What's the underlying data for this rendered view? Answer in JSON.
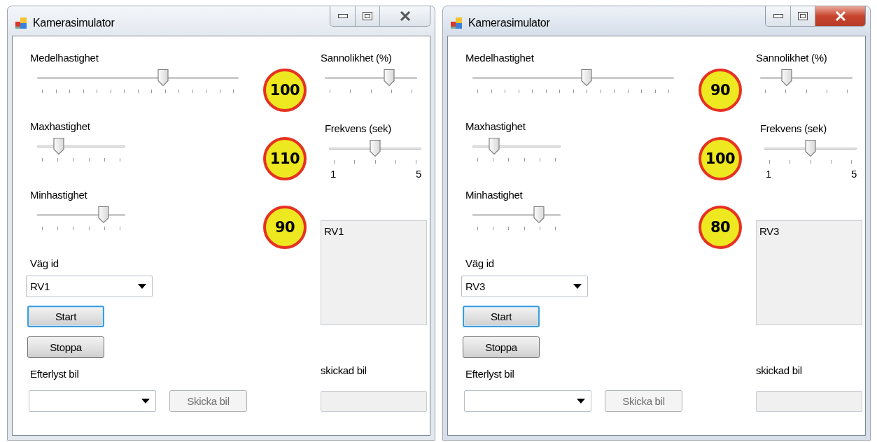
{
  "windows": [
    {
      "title": "Kamerasimulator",
      "active": false,
      "speed_sliders": [
        {
          "label": "Medelhastighet",
          "level": 0.63,
          "sign": "100"
        },
        {
          "label": "Maxhastighet",
          "level": 0.22,
          "sign": "110"
        },
        {
          "label": "Minhastighet",
          "level": 0.78,
          "sign": "90"
        }
      ],
      "probability": {
        "label": "Sannolikhet (%)",
        "level": 0.71
      },
      "frequency": {
        "label": "Frekvens (sek)",
        "level": 0.5,
        "min_label": "1",
        "max_label": "5"
      },
      "road": {
        "label": "Väg id",
        "value": "RV1"
      },
      "buttons": [
        {
          "label": "Start",
          "focused": true
        },
        {
          "label": "Stoppa",
          "focused": false
        }
      ],
      "wanted": {
        "label": "Efterlyst bil"
      },
      "send_button": {
        "label": "Skicka bil",
        "disabled": true
      },
      "log": [
        "RV1"
      ],
      "sent": {
        "label": "skickad bil"
      }
    },
    {
      "title": "Kamerasimulator",
      "active": true,
      "speed_sliders": [
        {
          "label": "Medelhastighet",
          "level": 0.57,
          "sign": "90"
        },
        {
          "label": "Maxhastighet",
          "level": 0.22,
          "sign": "100"
        },
        {
          "label": "Minhastighet",
          "level": 0.78,
          "sign": "80"
        }
      ],
      "probability": {
        "label": "Sannolikhet (%)",
        "level": 0.27
      },
      "frequency": {
        "label": "Frekvens (sek)",
        "level": 0.5,
        "min_label": "1",
        "max_label": "5"
      },
      "road": {
        "label": "Väg id",
        "value": "RV3"
      },
      "buttons": [
        {
          "label": "Start",
          "focused": true
        },
        {
          "label": "Stoppa",
          "focused": false
        }
      ],
      "wanted": {
        "label": "Efterlyst bil"
      },
      "send_button": {
        "label": "Skicka bil",
        "disabled": true
      },
      "log": [
        "RV3"
      ],
      "sent": {
        "label": "skickad bil"
      }
    }
  ]
}
